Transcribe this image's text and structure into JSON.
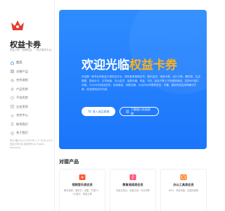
{
  "brand": {
    "name": "权益卡券",
    "slogan": "权益卡券 · 品牌权益 · 一站式服务平台"
  },
  "nav": {
    "items": [
      {
        "label": "首页",
        "icon": "home-icon"
      },
      {
        "label": "对接产品",
        "icon": "grid-icon"
      },
      {
        "label": "合作流程",
        "icon": "flow-icon"
      },
      {
        "label": "产品优势",
        "icon": "star-icon"
      },
      {
        "label": "平台优势",
        "icon": "shield-icon"
      },
      {
        "label": "企业资质",
        "icon": "certificate-icon"
      },
      {
        "label": "合作中心",
        "icon": "handshake-icon"
      },
      {
        "label": "联系我们",
        "icon": "phone-icon"
      },
      {
        "label": "关于我们",
        "icon": "info-icon"
      }
    ]
  },
  "footer": {
    "text": "鲁ICP备2022114597号-1 © 2018-2023 权益卡券平台 版权所有 All Rights Reserved"
  },
  "hero": {
    "title_main": "欢迎光临",
    "title_accent": "权益卡券",
    "description": "本站是一家专业的权益卡券供应平台，提供各类视频会员、音乐会员、电商卡券、出行卡券、餐饮券、生活缴费、游戏点卡、文学阅读、办公会员、话费充值、流量、Q币、加油卡等上千种虚拟商品，支持API接口对接，7x24小时自动发货，系统稳定，到账迅速，为合作伙伴提供安全、可靠、高效的权益采购解决方案，欢迎咨询合作共赢。",
    "btn_primary": "进入选品商城",
    "btn_secondary": "下载接口文档说明"
  },
  "products": {
    "section_title": "对接产品",
    "items": [
      {
        "title": "视频音乐类会员",
        "desc": "腾讯视频、爱奇艺、优酷、芒果TV、QQ音乐、网易云等",
        "icon": "video-icon"
      },
      {
        "title": "教育阅读类会员",
        "desc": "有道云笔记、百度文库、作业帮等",
        "icon": "book-icon"
      },
      {
        "title": "办公工具类会员",
        "desc": "WPS、有道词典、百度网盘等",
        "icon": "office-icon"
      }
    ]
  },
  "colors": {
    "accent": "#1e7bff",
    "highlight": "#ffb21a",
    "logo": "#e23b2e"
  }
}
